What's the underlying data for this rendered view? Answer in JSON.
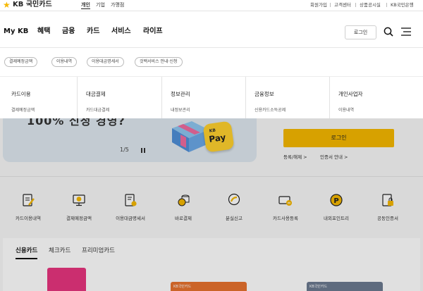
{
  "brand": {
    "logo_text": "KB 국민카드"
  },
  "segments": [
    "개인",
    "기업",
    "가맹점"
  ],
  "utility_links": [
    "회원가입",
    "고객센터",
    "상품공시실",
    "KB국민은행"
  ],
  "nav": {
    "items": [
      "My KB",
      "혜택",
      "금융",
      "카드",
      "서비스",
      "라이프"
    ],
    "login_label": "로그인"
  },
  "quick_menu": [
    "결제예정금액",
    "이용내역",
    "이용대금명세서",
    "것백서비스 안내·신청"
  ],
  "categories": [
    {
      "title": "카드이용",
      "sub": "결제예정금액"
    },
    {
      "title": "대금결제",
      "sub": "카드대금결제"
    },
    {
      "title": "정보관리",
      "sub": "내정보관리"
    },
    {
      "title": "금융정보",
      "sub": "신용카드소득공제"
    },
    {
      "title": "개인사업자",
      "sub": "이용내역"
    }
  ],
  "banner": {
    "text": "100% 신청 경영?",
    "pay_badge_kb": "KB",
    "pay_badge_word": "Pay",
    "pager": "1/5"
  },
  "login_panel": {
    "button": "로그인",
    "links": [
      "등록/해제 >",
      "인증서 안내 >"
    ]
  },
  "services": [
    "카드이용내역",
    "결제예정금액",
    "이용대금명세서",
    "바로결제",
    "분실신고",
    "카드사용등록",
    "내외포인트리",
    "공동인증서"
  ],
  "card_tabs": [
    "신용카드",
    "체크카드",
    "프리미엄카드"
  ],
  "card_thumbs": [
    "",
    "KB국민카드",
    "KB국민카드"
  ],
  "colors": {
    "accent": "#f5b800",
    "text": "#222222"
  }
}
